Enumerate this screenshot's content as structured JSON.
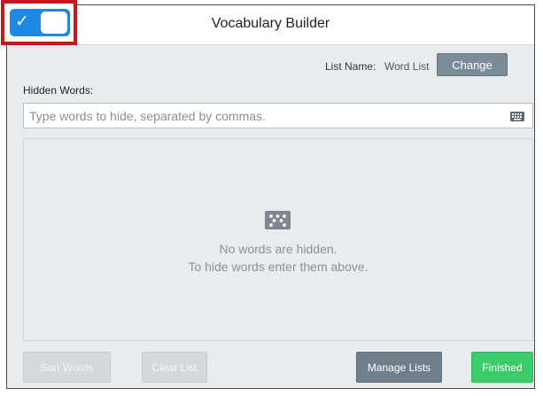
{
  "app": {
    "title": "Vocabulary Builder"
  },
  "toggle": {
    "checked": true,
    "icon": "check-icon",
    "accent_color": "#1e88e5",
    "highlight_color": "#c8161d"
  },
  "list": {
    "name_label": "List Name:",
    "name_value": "Word List",
    "change_label": "Change"
  },
  "hidden_words": {
    "label": "Hidden Words:",
    "value": "",
    "placeholder": "Type words to hide, separated by commas.",
    "keyboard_icon": "keyboard-icon"
  },
  "empty_state": {
    "icon": "dice-icon",
    "line1": "No words are hidden.",
    "line2": "To hide words enter them above."
  },
  "footer": {
    "sort_label": "Sort Words",
    "clear_label": "Clear List",
    "manage_label": "Manage Lists",
    "finished_label": "Finished",
    "finished_color": "#3ccb6b"
  }
}
